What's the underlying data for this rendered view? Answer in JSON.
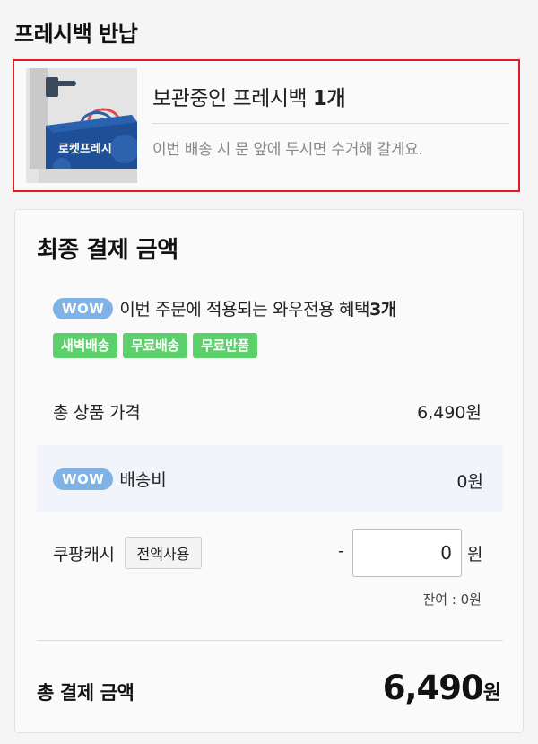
{
  "section_title": "프레시백 반납",
  "freshbag": {
    "image_text": "로켓프레시",
    "title_prefix": "보관중인 프레시백",
    "title_count": "1개",
    "description": "이번 배송 시 문 앞에 두시면 수거해 갈게요."
  },
  "payment": {
    "title": "최종 결제 금액",
    "wow_badge": "WOW",
    "benefit_text": "이번 주문에 적용되는 와우전용 혜택",
    "benefit_count": "3개",
    "tags": [
      "새벽배송",
      "무료배송",
      "무료반품"
    ],
    "product_total_label": "총 상품 가격",
    "product_total_value": "6,490원",
    "shipping_label": "배송비",
    "shipping_value": "0원",
    "cash_label": "쿠팡캐시",
    "use_all_button": "전액사용",
    "cash_minus": "-",
    "cash_input_value": "0",
    "cash_unit": "원",
    "cash_balance": "잔여 : 0원",
    "total_label": "총 결제 금액",
    "total_amount": "6,490",
    "total_unit": "원"
  },
  "colors": {
    "highlight_border": "#e41b23",
    "wow_badge": "#7fb3e8",
    "tag_green": "#5cd06a",
    "shipping_row_bg": "#f1f4fa"
  }
}
